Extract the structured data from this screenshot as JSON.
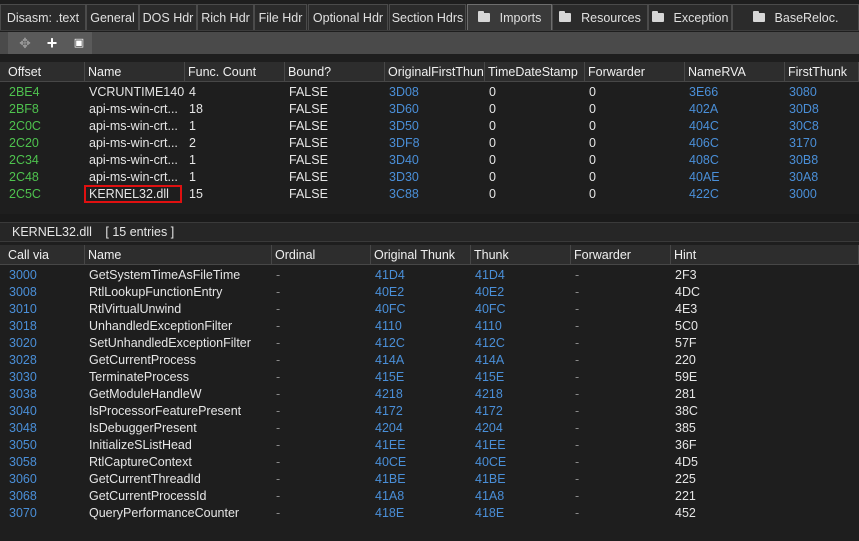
{
  "tabs": [
    {
      "label": "Disasm: .text",
      "folder": false,
      "active": false
    },
    {
      "label": "General",
      "folder": false,
      "active": false
    },
    {
      "label": "DOS Hdr",
      "folder": false,
      "active": false
    },
    {
      "label": "Rich Hdr",
      "folder": false,
      "active": false
    },
    {
      "label": "File Hdr",
      "folder": false,
      "active": false
    },
    {
      "label": "Optional Hdr",
      "folder": false,
      "active": false
    },
    {
      "label": "Section Hdrs",
      "folder": false,
      "active": false
    },
    {
      "label": "Imports",
      "folder": true,
      "active": true
    },
    {
      "label": "Resources",
      "folder": true,
      "active": false
    },
    {
      "label": "Exception",
      "folder": true,
      "active": false
    },
    {
      "label": "BaseReloc.",
      "folder": true,
      "active": false
    }
  ],
  "toolbar": {
    "move_icon": "move-icon",
    "add_icon": "plus-icon",
    "save_icon": "save-icon",
    "move_glyph": "✥",
    "add_glyph": "+",
    "save_glyph": "▣"
  },
  "imports_table": {
    "columns": [
      "Offset",
      "Name",
      "Func. Count",
      "Bound?",
      "OriginalFirstThun",
      "TimeDateStamp",
      "Forwarder",
      "NameRVA",
      "FirstThunk"
    ],
    "rows": [
      [
        "2BE4",
        "VCRUNTIME140...",
        "4",
        "FALSE",
        "3D08",
        "0",
        "0",
        "3E66",
        "3080"
      ],
      [
        "2BF8",
        "api-ms-win-crt...",
        "18",
        "FALSE",
        "3D60",
        "0",
        "0",
        "402A",
        "30D8"
      ],
      [
        "2C0C",
        "api-ms-win-crt...",
        "1",
        "FALSE",
        "3D50",
        "0",
        "0",
        "404C",
        "30C8"
      ],
      [
        "2C20",
        "api-ms-win-crt...",
        "2",
        "FALSE",
        "3DF8",
        "0",
        "0",
        "406C",
        "3170"
      ],
      [
        "2C34",
        "api-ms-win-crt...",
        "1",
        "FALSE",
        "3D40",
        "0",
        "0",
        "408C",
        "30B8"
      ],
      [
        "2C48",
        "api-ms-win-crt...",
        "1",
        "FALSE",
        "3D30",
        "0",
        "0",
        "40AE",
        "30A8"
      ],
      [
        "2C5C",
        "KERNEL32.dll",
        "15",
        "FALSE",
        "3C88",
        "0",
        "0",
        "422C",
        "3000"
      ]
    ],
    "selected_index": 6
  },
  "infobar": {
    "dll_name": "KERNEL32.dll",
    "entries": "[ 15 entries ]"
  },
  "functions_table": {
    "columns": [
      "Call via",
      "Name",
      "Ordinal",
      "Original Thunk",
      "Thunk",
      "Forwarder",
      "Hint"
    ],
    "rows": [
      [
        "3000",
        "GetSystemTimeAsFileTime",
        "-",
        "41D4",
        "41D4",
        "-",
        "2F3"
      ],
      [
        "3008",
        "RtlLookupFunctionEntry",
        "-",
        "40E2",
        "40E2",
        "-",
        "4DC"
      ],
      [
        "3010",
        "RtlVirtualUnwind",
        "-",
        "40FC",
        "40FC",
        "-",
        "4E3"
      ],
      [
        "3018",
        "UnhandledExceptionFilter",
        "-",
        "4110",
        "4110",
        "-",
        "5C0"
      ],
      [
        "3020",
        "SetUnhandledExceptionFilter",
        "-",
        "412C",
        "412C",
        "-",
        "57F"
      ],
      [
        "3028",
        "GetCurrentProcess",
        "-",
        "414A",
        "414A",
        "-",
        "220"
      ],
      [
        "3030",
        "TerminateProcess",
        "-",
        "415E",
        "415E",
        "-",
        "59E"
      ],
      [
        "3038",
        "GetModuleHandleW",
        "-",
        "4218",
        "4218",
        "-",
        "281"
      ],
      [
        "3040",
        "IsProcessorFeaturePresent",
        "-",
        "4172",
        "4172",
        "-",
        "38C"
      ],
      [
        "3048",
        "IsDebuggerPresent",
        "-",
        "4204",
        "4204",
        "-",
        "385"
      ],
      [
        "3050",
        "InitializeSListHead",
        "-",
        "41EE",
        "41EE",
        "-",
        "36F"
      ],
      [
        "3058",
        "RtlCaptureContext",
        "-",
        "40CE",
        "40CE",
        "-",
        "4D5"
      ],
      [
        "3060",
        "GetCurrentThreadId",
        "-",
        "41BE",
        "41BE",
        "-",
        "225"
      ],
      [
        "3068",
        "GetCurrentProcessId",
        "-",
        "41A8",
        "41A8",
        "-",
        "221"
      ],
      [
        "3070",
        "QueryPerformanceCounter",
        "-",
        "418E",
        "418E",
        "-",
        "452"
      ]
    ]
  },
  "colors": {
    "background": "#1e1e1e",
    "offset_green": "#4ec24e",
    "rva_blue": "#4a8fd8",
    "selection_red": "#e01010"
  }
}
